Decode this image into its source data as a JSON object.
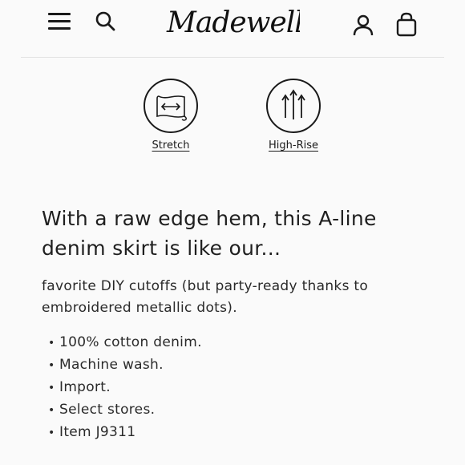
{
  "header": {
    "brand": "Madewell",
    "menu_icon": "hamburger-menu-icon",
    "search_icon": "search-icon",
    "account_icon": "account-icon",
    "bag_icon": "shopping-bag-icon"
  },
  "features": [
    {
      "label": "Stretch",
      "icon": "stretch-icon"
    },
    {
      "label": "High-Rise",
      "icon": "high-rise-icon"
    }
  ],
  "description": {
    "headline": "With a raw edge hem, this A-line denim skirt is like our...",
    "body": "favorite DIY cutoffs (but party-ready thanks to embroidered metallic dots).",
    "bullets": [
      "100% cotton denim.",
      "Machine wash.",
      "Import.",
      "Select stores.",
      "Item J9311"
    ]
  }
}
